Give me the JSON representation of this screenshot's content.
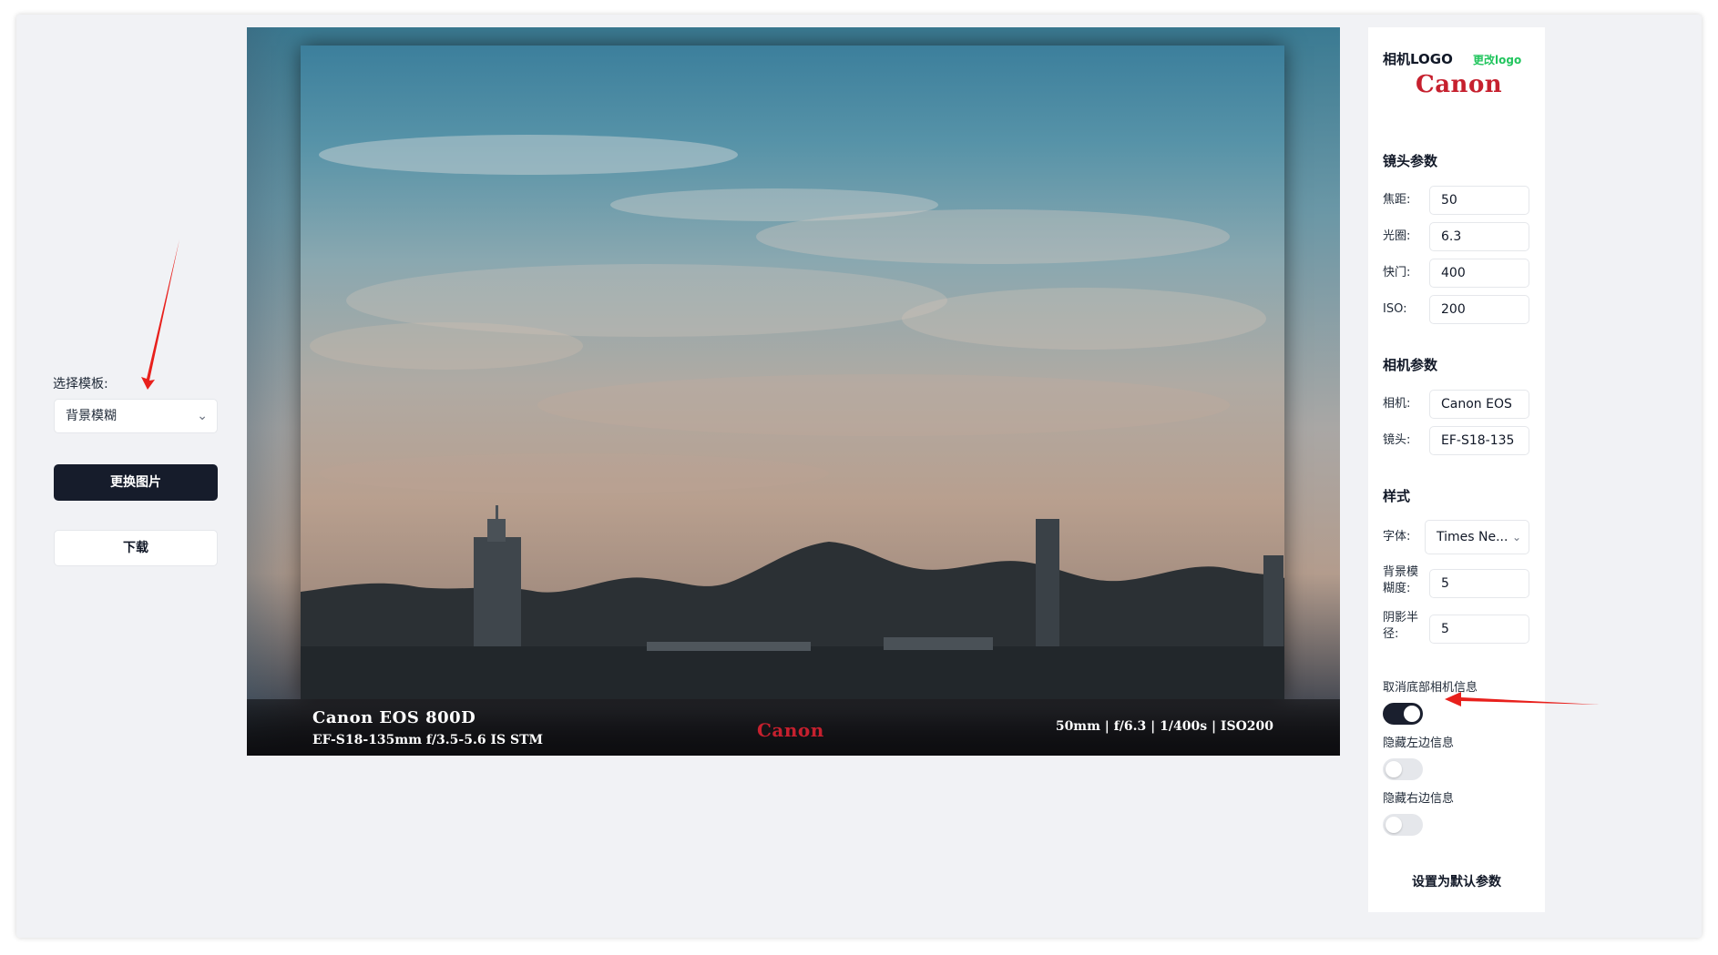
{
  "left_panel": {
    "template_label": "选择模板:",
    "template_value": "背景模糊",
    "replace_image": "更换图片",
    "download": "下载"
  },
  "preview": {
    "camera_model": "Canon EOS 800D",
    "lens_model": "EF-S18-135mm f/3.5-5.6 IS STM",
    "logo_text": "Canon",
    "exif": "50mm | f/6.3 | 1/400s | ISO200"
  },
  "right_panel": {
    "logo_section_title": "相机LOGO",
    "change_logo": "更改logo",
    "logo_text": "Canon",
    "lens_section_title": "镜头参数",
    "focal_label": "焦距:",
    "focal_value": "50",
    "aperture_label": "光圈:",
    "aperture_value": "6.3",
    "shutter_label": "快门:",
    "shutter_value": "400",
    "iso_label": "ISO:",
    "iso_value": "200",
    "camera_section_title": "相机参数",
    "camera_label": "相机:",
    "camera_value": "Canon EOS",
    "lens_label": "镜头:",
    "lens_value": "EF-S18-135",
    "style_section_title": "样式",
    "font_label": "字体:",
    "font_value": "Times Ne...",
    "blur_label_1": "背景模",
    "blur_label_2": "糊度:",
    "blur_value": "5",
    "shadow_label_1": "阴影半",
    "shadow_label_2": "径:",
    "shadow_value": "5",
    "toggle_bottom_info_label": "取消底部相机信息",
    "toggle_bottom_info_on": true,
    "toggle_left_info_label": "隐藏左边信息",
    "toggle_left_info_on": false,
    "toggle_right_info_label": "隐藏右边信息",
    "toggle_right_info_on": false,
    "set_default": "设置为默认参数"
  },
  "colors": {
    "page_bg": "#f1f2f5",
    "dark_button": "#161c2b",
    "canon_red": "#c6202e",
    "change_logo_green": "#22c55e",
    "annotation_red": "#e8201c"
  }
}
